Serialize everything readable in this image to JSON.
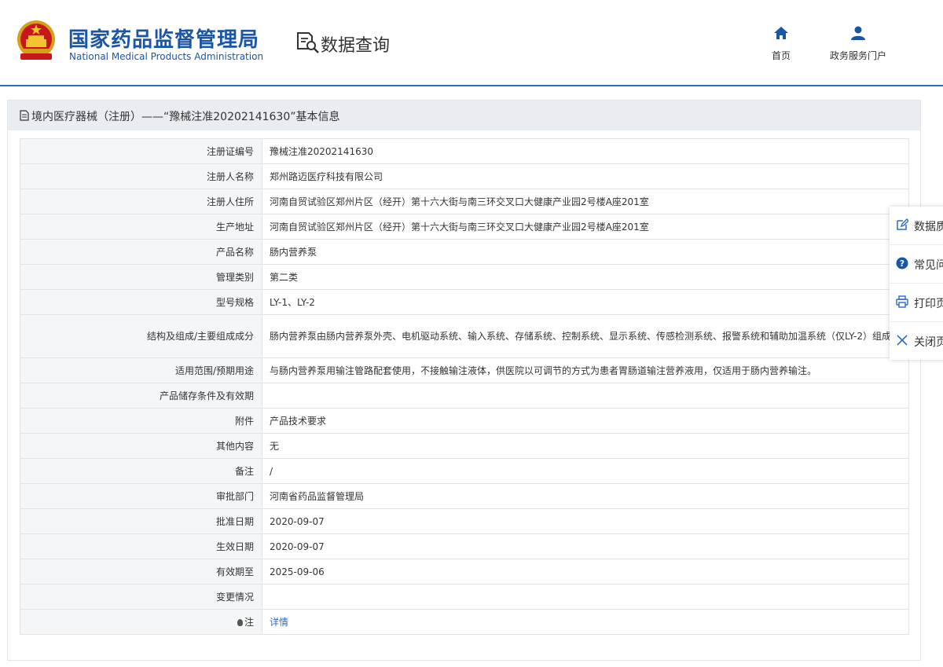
{
  "header": {
    "site_name_cn": "国家药品监督管理局",
    "site_name_en": "National Medical Products Administration",
    "section_title": "数据查询",
    "nav": [
      {
        "label": "首页",
        "icon": "home-icon"
      },
      {
        "label": "政务服务门户",
        "icon": "user-icon"
      }
    ],
    "accent_color": "#1b55a5"
  },
  "panel": {
    "title": "境内医疗器械（注册）——“豫械注准20202141630”基本信息",
    "rows": [
      {
        "label": "注册证编号",
        "value": "豫械注准20202141630"
      },
      {
        "label": "注册人名称",
        "value": "郑州路迈医疗科技有限公司"
      },
      {
        "label": "注册人住所",
        "value": "河南自贸试验区郑州片区（经开）第十六大街与南三环交叉口大健康产业园2号楼A座201室"
      },
      {
        "label": "生产地址",
        "value": "河南自贸试验区郑州片区（经开）第十六大街与南三环交叉口大健康产业园2号楼A座201室"
      },
      {
        "label": "产品名称",
        "value": "肠内营养泵"
      },
      {
        "label": "管理类别",
        "value": "第二类"
      },
      {
        "label": "型号规格",
        "value": "LY-1、LY-2"
      },
      {
        "label": "结构及组成/主要组成成分",
        "value": "肠内营养泵由肠内营养泵外壳、电机驱动系统、输入系统、存储系统、控制系统、显示系统、传感检测系统、报警系统和辅助加温系统（仅LY-2）组成。"
      },
      {
        "label": "适用范围/预期用途",
        "value": "与肠内营养泵用输注管路配套使用，不接触输注液体，供医院以可调节的方式为患者胃肠道输注营养液用，仅适用于肠内营养输注。"
      },
      {
        "label": "产品储存条件及有效期",
        "value": ""
      },
      {
        "label": "附件",
        "value": "产品技术要求"
      },
      {
        "label": "其他内容",
        "value": "无"
      },
      {
        "label": "备注",
        "value": "/"
      },
      {
        "label": "审批部门",
        "value": "河南省药品监督管理局"
      },
      {
        "label": "批准日期",
        "value": "2020-09-07"
      },
      {
        "label": "生效日期",
        "value": "2020-09-07"
      },
      {
        "label": "有效期至",
        "value": "2025-09-06"
      },
      {
        "label": "变更情况",
        "value": ""
      },
      {
        "label": "注",
        "value": "详情"
      }
    ]
  },
  "side_tools": [
    {
      "label": "数据质量",
      "icon": "edit-icon"
    },
    {
      "label": "常见问题",
      "icon": "help-icon"
    },
    {
      "label": "打印页面",
      "icon": "print-icon"
    },
    {
      "label": "关闭页面",
      "icon": "close-icon"
    }
  ]
}
